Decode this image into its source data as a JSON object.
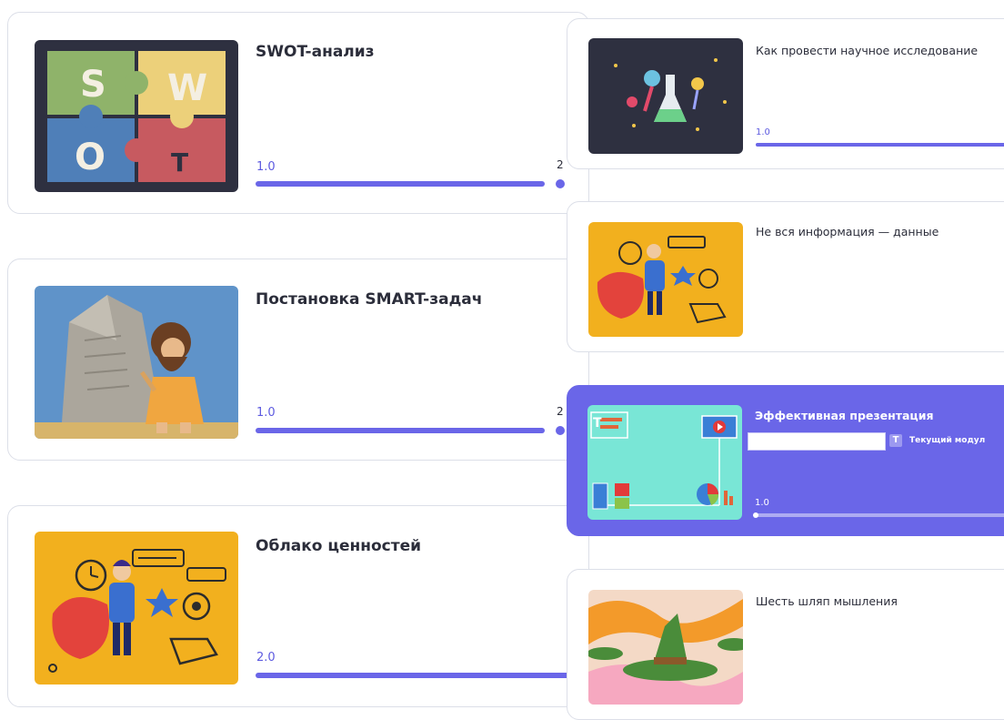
{
  "left_cards": [
    {
      "title": "SWOT-анализ",
      "version": "1.0",
      "edge_label": "2"
    },
    {
      "title": "Постановка SMART-задач",
      "version": "1.0",
      "edge_label": "2"
    },
    {
      "title": "Облако ценностей",
      "version": "2.0",
      "edge_label": ""
    }
  ],
  "right_cards": [
    {
      "title": "Как провести научное исследование",
      "version": "1.0"
    },
    {
      "title": "Не вся информация — данные",
      "version": ""
    },
    {
      "title": "Эффективная презентация",
      "version": "1.0",
      "current_label": "Текущий модул",
      "badge": "T"
    },
    {
      "title": "Шесть шляп мышления",
      "version": ""
    }
  ],
  "thumb_text": {
    "swot": [
      "S",
      "W",
      "O",
      "T"
    ]
  },
  "icons": [
    "swot-puzzle-icon",
    "stone-tablet-caveman-icon",
    "values-cloud-icon",
    "science-lab-icon",
    "data-person-icon",
    "presentation-slide-icon",
    "wizard-hat-icon",
    "text-badge-icon"
  ],
  "colors": {
    "accent": "#6a66e8",
    "card_border": "#dcdfe8",
    "thumb_yellow": "#f2b01e",
    "thumb_dark": "#2e3040"
  }
}
